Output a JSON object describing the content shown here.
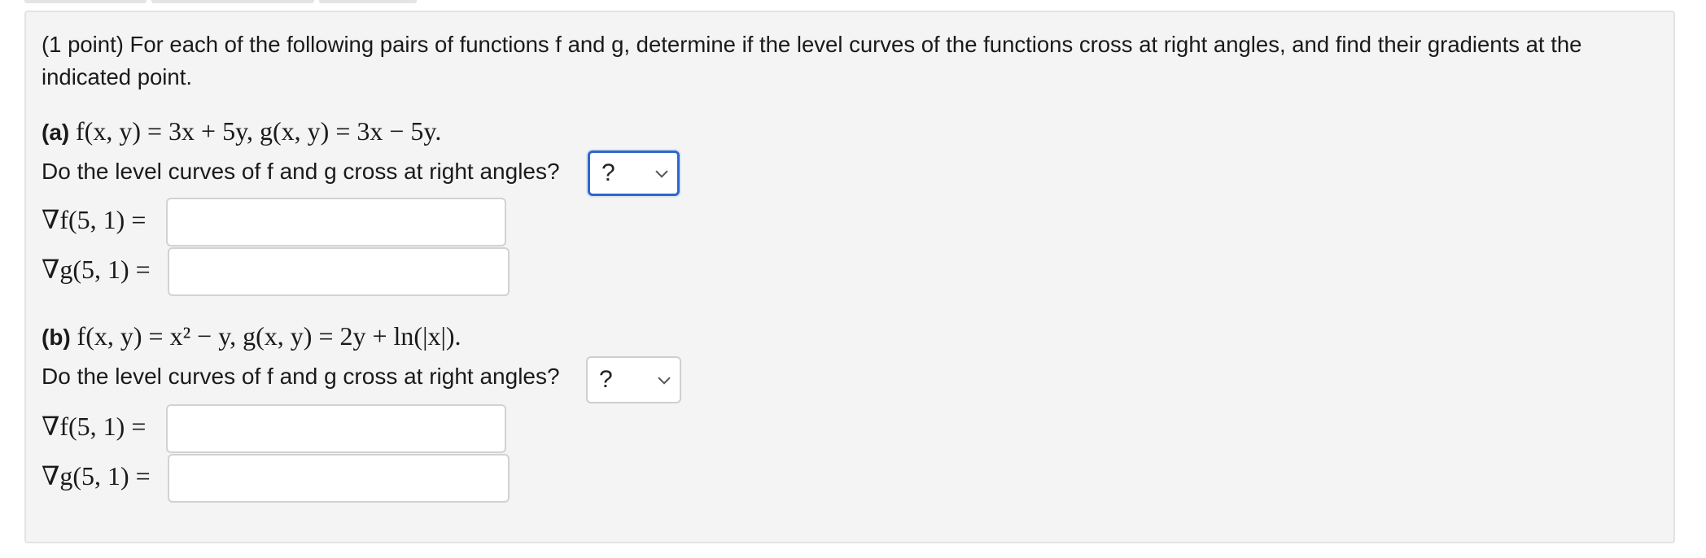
{
  "problem": {
    "intro_line1": "(1 point) For each of the following pairs of functions f and g, determine if the level curves of the functions cross at right angles, and find their gradients at the",
    "intro_line2": "indicated point."
  },
  "part_a": {
    "label": "(a)",
    "functions": "f(x, y) = 3x + 5y, g(x, y) = 3x − 5y.",
    "question": "Do the level curves of f and g cross at right angles?",
    "select_value": "?",
    "grad_f_label": "∇f(5, 1) =",
    "grad_f_value": "",
    "grad_g_label": "∇g(5, 1) =",
    "grad_g_value": ""
  },
  "part_b": {
    "label": "(b)",
    "functions": "f(x, y) = x² − y, g(x, y) = 2y + ln(|x|).",
    "question": "Do the level curves of f and g cross at right angles?",
    "select_value": "?",
    "grad_f_label": "∇f(5, 1) =",
    "grad_f_value": "",
    "grad_g_label": "∇g(5, 1) =",
    "grad_g_value": ""
  },
  "icons": {
    "dropdown": "chevron-down-icon"
  },
  "colors": {
    "panel_bg": "#f4f4f4",
    "focus_border": "#2f66c9"
  }
}
